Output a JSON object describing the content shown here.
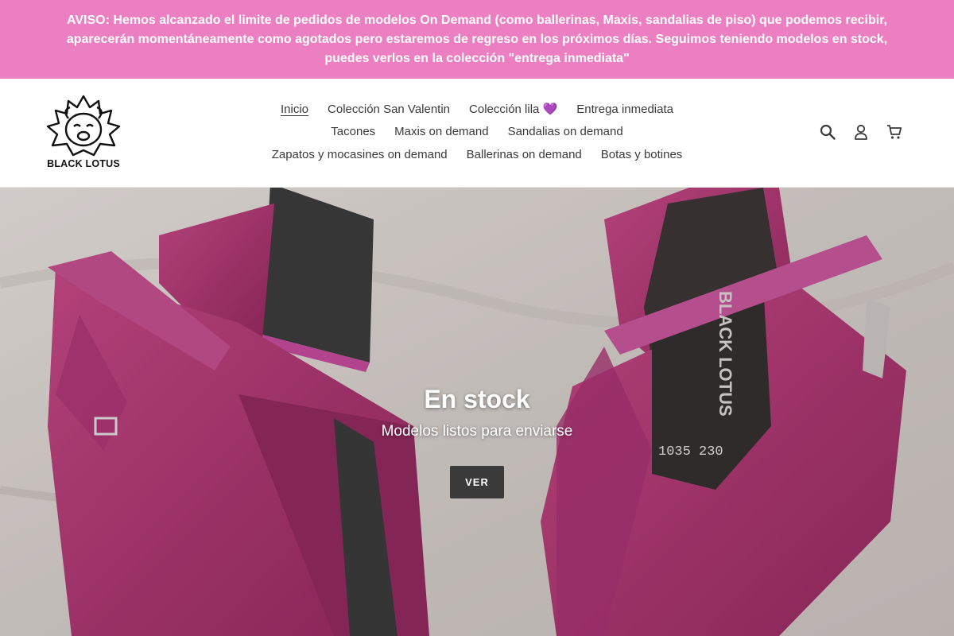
{
  "announcement": {
    "text": "AVISO: Hemos alcanzado el limite de pedidos de modelos On Demand (como ballerinas, Maxis, sandalias de piso) que podemos recibir, aparecerán momentáneamente como agotados pero estaremos de regreso en los próximos días. Seguimos teniendo modelos en stock, puedes verlos en la colección \"entrega inmediata\"",
    "bg_color": "#eb7fc2"
  },
  "header": {
    "logo_text": "BLACK LOTUS",
    "nav": {
      "row1": [
        {
          "label": "Inicio",
          "active": true
        },
        {
          "label": "Colección San Valentin"
        },
        {
          "label": "Colección lila 💜"
        },
        {
          "label": "Entrega inmediata"
        }
      ],
      "row2": [
        {
          "label": "Tacones"
        },
        {
          "label": "Maxis on demand"
        },
        {
          "label": "Sandalias on demand"
        }
      ],
      "row3": [
        {
          "label": "Zapatos y mocasines on demand"
        },
        {
          "label": "Ballerinas on demand"
        },
        {
          "label": "Botas y botines"
        }
      ]
    },
    "icons": [
      "search-icon",
      "account-icon",
      "cart-icon"
    ]
  },
  "hero": {
    "title": "En stock",
    "subtitle": "Modelos listos para enviarse",
    "button_label": "VER",
    "shoe_color": "#b23a77",
    "insole_text": "BLACK LOTUS",
    "insole_code": "1035 230"
  }
}
